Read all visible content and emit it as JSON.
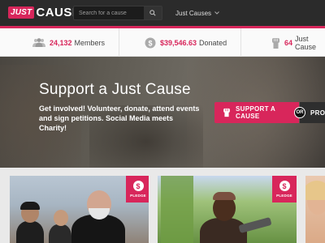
{
  "header": {
    "logo_just": "JUST",
    "logo_cause": "CAUSE",
    "search_placeholder": "Search for a cause",
    "causes_dropdown": "Just Causes"
  },
  "stats": {
    "members_count": "24,132",
    "members_label": "Members",
    "donated_amount": "$39,546.63",
    "donated_label": "Donated",
    "causes_count": "64",
    "causes_label": "Just Cause"
  },
  "hero": {
    "title": "Support a Just Cause",
    "subtitle": "Get involved! Volunteer, donate, attend events and sign petitions. Social Media meets Charity!",
    "support_button": "SUPPORT A CAUSE",
    "or_label": "OR",
    "pro_button": "PRO"
  },
  "cards": {
    "pledge_label": "PLEDGE",
    "pledge_symbol": "$"
  },
  "colors": {
    "accent": "#d8265b",
    "topbar": "#2b2b2b"
  }
}
